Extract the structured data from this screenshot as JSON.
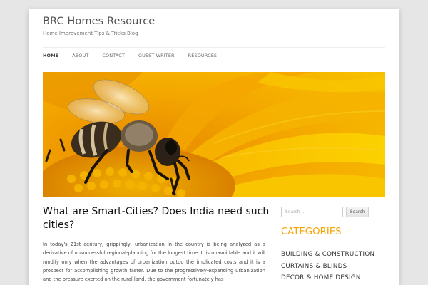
{
  "site": {
    "title": "BRC Homes Resource",
    "description": "Home Improvement Tips & Tricks Blog"
  },
  "nav": {
    "items": [
      {
        "label": "HOME"
      },
      {
        "label": "ABOUT"
      },
      {
        "label": "CONTACT"
      },
      {
        "label": "GUEST WRITER"
      },
      {
        "label": "RESOURCES"
      }
    ],
    "active": "HOME"
  },
  "header_image": {
    "subject": "honeybee on yellow-orange flower"
  },
  "post": {
    "title": "What are Smart-Cities? Does India need such cities?",
    "excerpt": "In today's 21st century, grippingly, urbanization in the country is being analyzed as a derivative of unsuccessful regional-planning for the longest time. It is unavoidable and it will modify only when the advantages of urbanization outdo the implicated costs and it is a prospect for accomplishing growth faster. Due to the progressively-expanding urbanization and the pressure exerted on the rural land, the government fortunately has"
  },
  "search": {
    "placeholder": "Search ...",
    "button_label": "Search"
  },
  "sidebar": {
    "categories_title": "CATEGORIES",
    "categories": [
      {
        "label": "BUILDING & CONSTRUCTION"
      },
      {
        "label": "CURTAINS & BLINDS"
      },
      {
        "label": "DECOR & HOME DESIGN"
      }
    ]
  },
  "colors": {
    "accent": "#f4a300",
    "background": "#e6e6e6"
  }
}
